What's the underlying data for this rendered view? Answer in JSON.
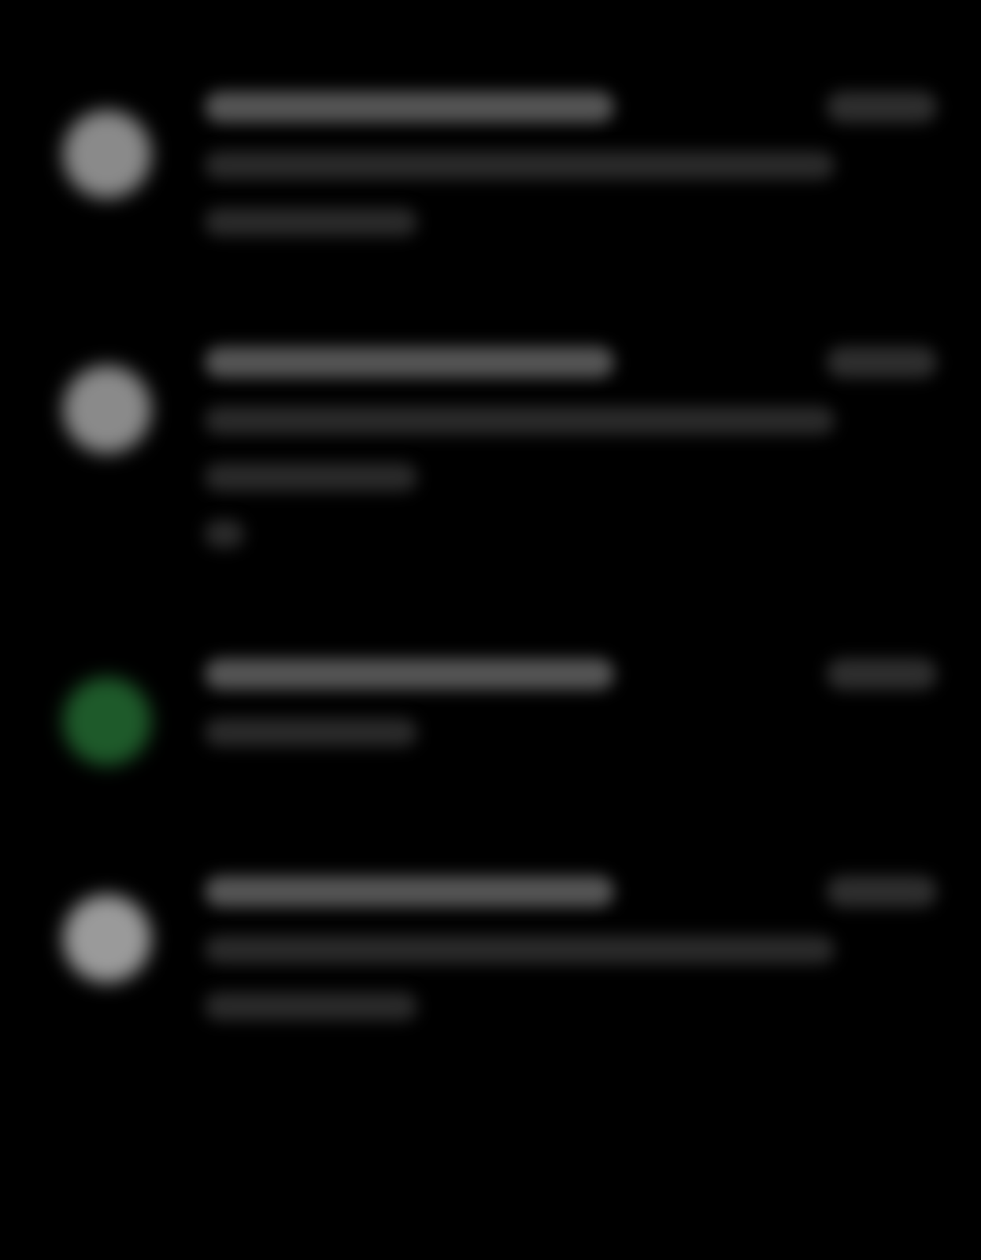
{
  "notifications": [
    {
      "color": "#8a8a8a",
      "title": {
        "kind": "medium"
      },
      "time": {
        "kind": "time"
      },
      "lines": [
        {
          "kind": "long"
        },
        {
          "kind": "short"
        }
      ]
    },
    {
      "color": "#8a8a8a",
      "title": {
        "kind": "medium"
      },
      "time": {
        "kind": "time"
      },
      "lines": [
        {
          "kind": "long"
        },
        {
          "kind": "short"
        },
        {
          "kind": "tiny"
        }
      ]
    },
    {
      "color": "#1e5a2a",
      "title": {
        "kind": "medium"
      },
      "time": {
        "kind": "time"
      },
      "lines": [
        {
          "kind": "short"
        }
      ]
    },
    {
      "color": "#9a9a9a",
      "title": {
        "kind": "medium"
      },
      "time": {
        "kind": "time"
      },
      "lines": [
        {
          "kind": "long"
        },
        {
          "kind": "short"
        }
      ]
    }
  ]
}
